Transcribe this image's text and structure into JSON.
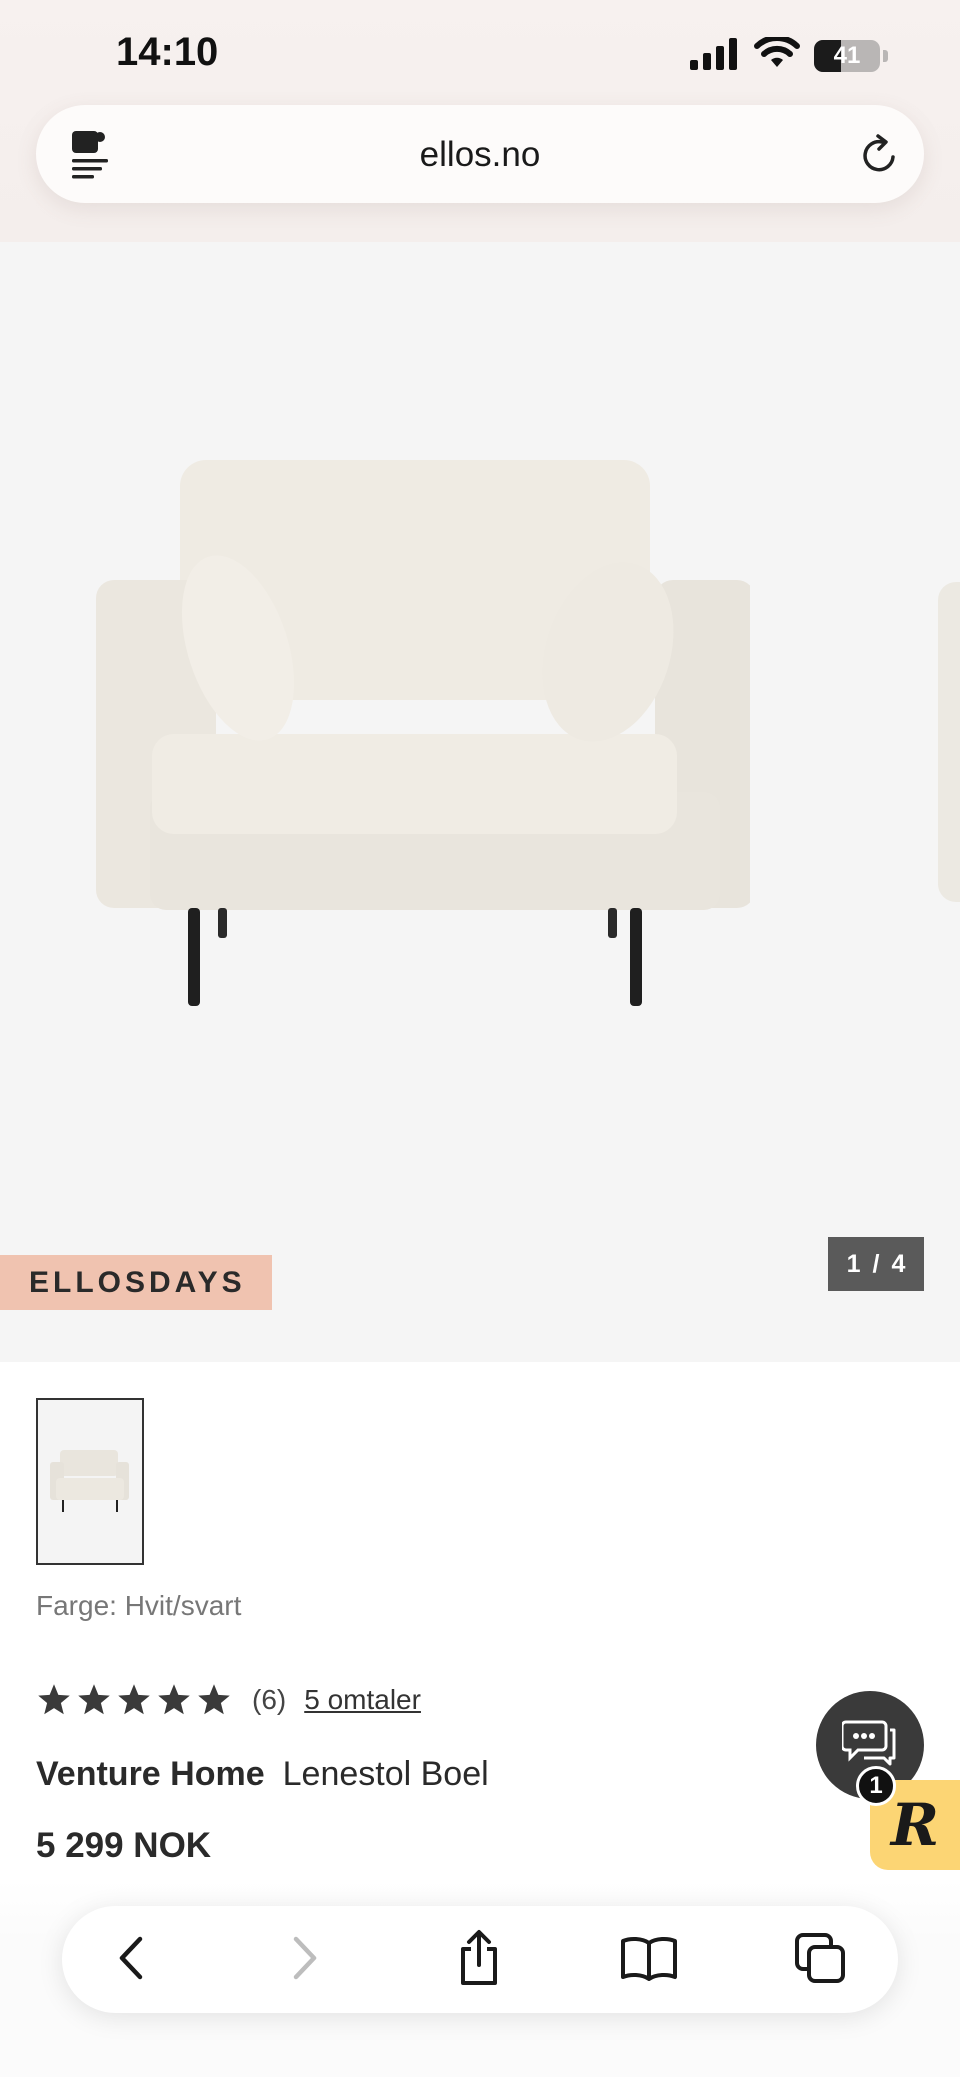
{
  "status_bar": {
    "time": "14:10",
    "battery_level": "41",
    "icons": [
      "cellular-signal-icon",
      "wifi-icon",
      "battery-icon"
    ]
  },
  "browser": {
    "url": "ellos.no",
    "left_icon": "reader-extension-icon",
    "right_icon": "reload-icon"
  },
  "gallery": {
    "promo_badge": "ELLOSDAYS",
    "current_image": "1",
    "separator": "/",
    "total_images": "4"
  },
  "product": {
    "color_label": "Farge: Hvit/svart",
    "rating_stars": 5,
    "rating_count": "(6)",
    "reviews_link": "5 omtaler",
    "brand": "Venture Home",
    "name": "Lenestol Boel",
    "price": "5 299 NOK"
  },
  "chat": {
    "icon": "chat-bubbles-icon",
    "badge_count": "1",
    "widget_letter": "R"
  },
  "toolbar": {
    "items": [
      "back-icon",
      "forward-icon",
      "share-icon",
      "bookmarks-icon",
      "tabs-icon"
    ]
  },
  "colors": {
    "promo_badge_bg": "#f0c3b0",
    "counter_bg": "#5a5a5a",
    "chat_bg": "#3a3a3a",
    "r_widget_bg": "#fcd574"
  }
}
